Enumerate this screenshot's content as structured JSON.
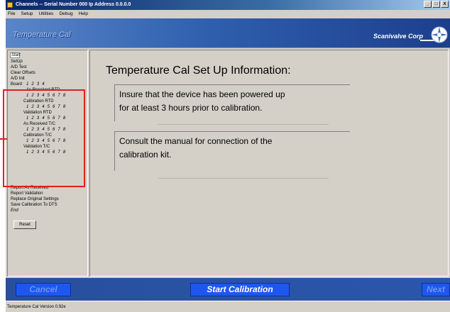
{
  "window": {
    "title": "Channels  -- Serial Number 000  Ip Address 0.0.0.0",
    "controls": [
      "_",
      "□",
      "X"
    ]
  },
  "menu": [
    "File",
    "Setup",
    "Utilities",
    "Debug",
    "Help"
  ],
  "banner": {
    "mode_title": "Temperature Cal",
    "company": "Scanivalve Corp"
  },
  "nav": {
    "start": "Start",
    "setup": "SetUp",
    "ad_test": "A/D Test",
    "clear_offsets": "Clear Offsets",
    "ad_init": "A/D Init",
    "board_label": "Board",
    "boards": "1  2  3  4",
    "as_received_rtd": "As Received RTD",
    "calibration_rtd": "Calibration RTD",
    "validation_rtd": "Validation RTD",
    "as_received_tc": "As Received T/C",
    "calibration_tc": "Calibration T/C",
    "validation_tc": "Validation T/C",
    "channels": "1 2 3 4 5 6 7 8",
    "report_as_received": "Report As Received",
    "report_validation": "Report Validation",
    "replace_original": "Replace Original Settings",
    "save_calibration": "Save Calibration To DTS",
    "end": "End",
    "reset": "Reset"
  },
  "main": {
    "heading": "Temperature Cal Set Up Information:",
    "box1_line1": "Insure that the device has been powered up",
    "box1_line2": "for at least 3 hours prior to calibration.",
    "box2_line1": "Consult the manual for connection of the",
    "box2_line2": "calibration kit."
  },
  "buttons": {
    "cancel": "Cancel",
    "start_calibration": "Start Calibration",
    "next": "Next"
  },
  "status": "Temperature Cal Version 0.92e",
  "colors": {
    "highlight": "#e0201a",
    "button_blue": "#1d57f0",
    "banner_blue": "#2f5fae"
  }
}
